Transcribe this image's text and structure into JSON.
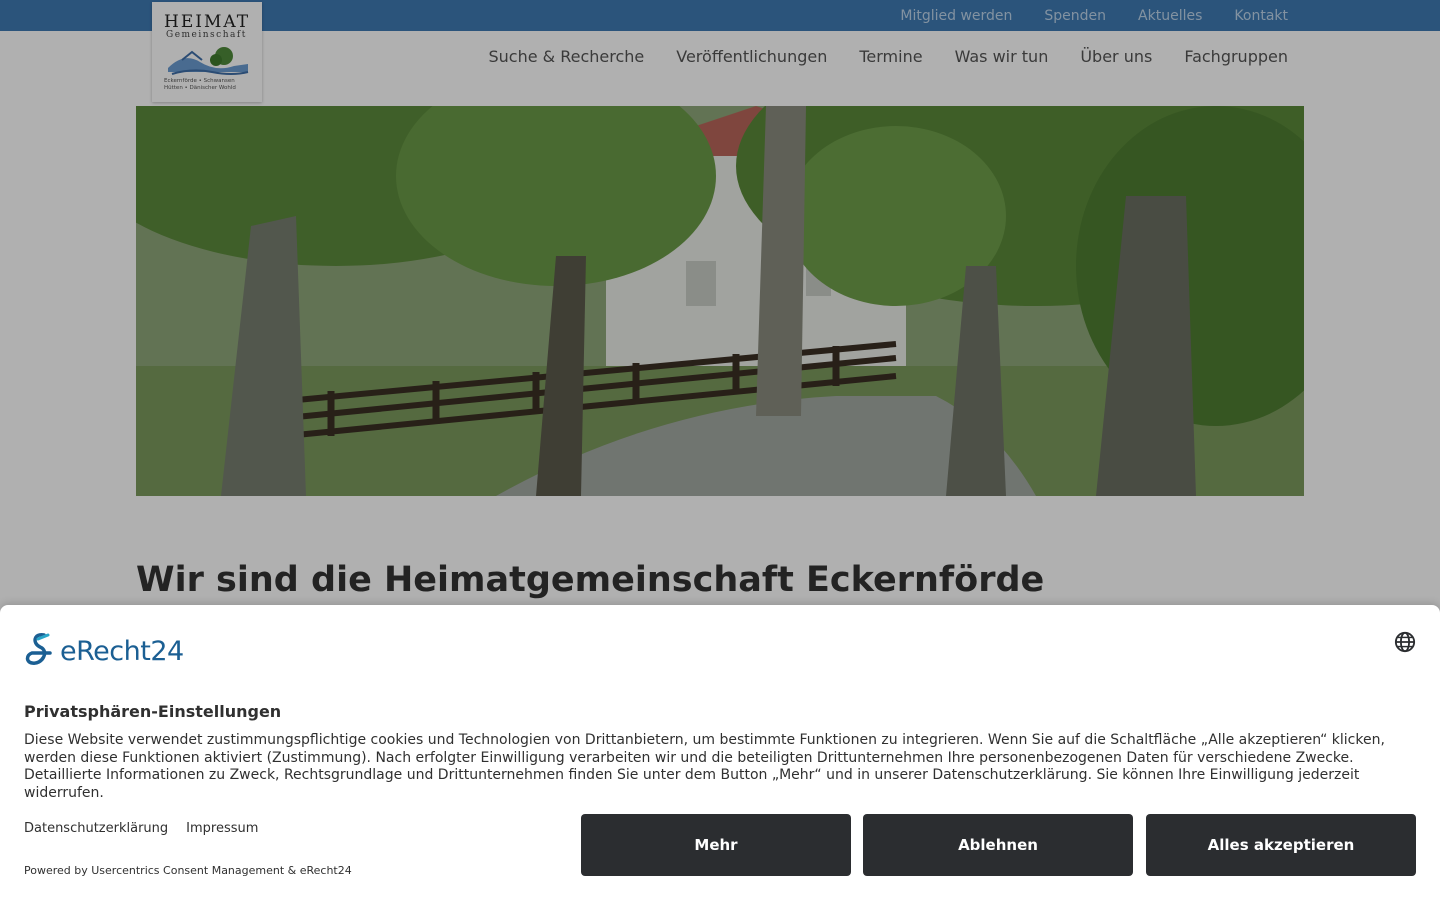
{
  "logo": {
    "line1": "HEIMAT",
    "line2": "Gemeinschaft",
    "line3": "Eckernförde • Schwansen",
    "line4": "Hütten • Dänischer Wohld"
  },
  "topnav": {
    "items": [
      "Mitglied werden",
      "Spenden",
      "Aktuelles",
      "Kontakt"
    ]
  },
  "mainnav": {
    "items": [
      "Suche & Recherche",
      "Veröffentlichungen",
      "Termine",
      "Was wir tun",
      "Über uns",
      "Fachgruppen"
    ]
  },
  "main": {
    "headline": "Wir sind die Heimatgemeinschaft Eckernförde"
  },
  "consent": {
    "brand": "eRecht24",
    "title": "Privatsphären-Einstellungen",
    "text": "Diese Website verwendet zustimmungspflichtige cookies und Technologien von Drittanbietern, um bestimmte Funktionen zu integrieren. Wenn Sie auf die Schaltfläche „Alle akzeptieren“ klicken, werden diese Funktionen aktiviert (Zustimmung). Nach erfolgter Einwilligung verarbeiten wir und die beteiligten Drittunternehmen Ihre personenbezogenen Daten für verschiedene Zwecke. Detaillierte Informationen zu Zweck, Rechtsgrundlage und Drittunternehmen finden Sie unter dem Button „Mehr“ und in unserer Datenschutzerklärung. Sie können Ihre Einwilligung jederzeit widerrufen.",
    "link_privacy": "Datenschutzerklärung",
    "link_imprint": "Impressum",
    "powered": "Powered by Usercentrics Consent Management & eRecht24",
    "btn_more": "Mehr",
    "btn_deny": "Ablehnen",
    "btn_accept": "Alles akzeptieren"
  },
  "colors": {
    "topbar": "#3f7ab3",
    "button": "#2b2d30",
    "brand": "#1b5f93"
  },
  "icons": [
    "language-globe-icon",
    "erecht24-logo-icon"
  ]
}
